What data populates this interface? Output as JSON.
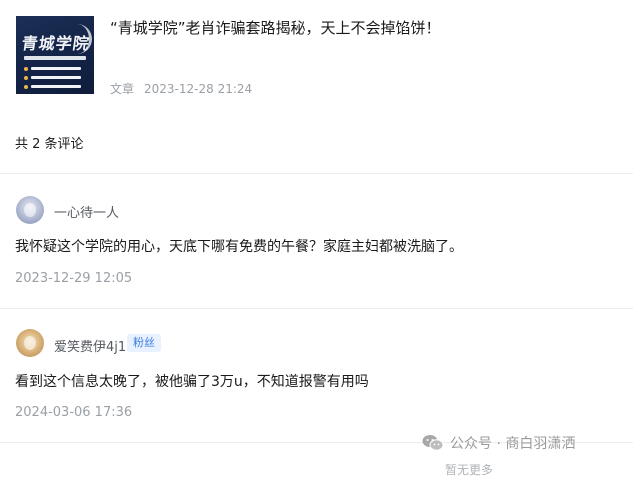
{
  "article": {
    "title": "“青城学院”老肖诈骗套路揭秘，天上不会掉馅饼！",
    "type": "文章",
    "date": "2023-12-28 21:24",
    "thumbnail_text": "青城学院"
  },
  "comments_count": "共 2 条评论",
  "comments": [
    {
      "name": "一心待一人",
      "text": "我怀疑这个学院的用心，天底下哪有免费的午餐？家庭主妇都被洗脑了。",
      "time": "2023-12-29 12:05",
      "badge": ""
    },
    {
      "name": "爱笑费伊4j1",
      "text": "看到这个信息太晚了，被他骗了3万u，不知道报警有用吗",
      "time": "2024-03-06 17:36",
      "badge": "粉丝"
    }
  ],
  "watermark": "公众号 · 商白羽潇洒",
  "more_label": "暂无更多",
  "colors": {
    "badge_text": "#3d7de0",
    "badge_bg": "#e8f1ff",
    "meta_gray": "#9aa0a6"
  }
}
